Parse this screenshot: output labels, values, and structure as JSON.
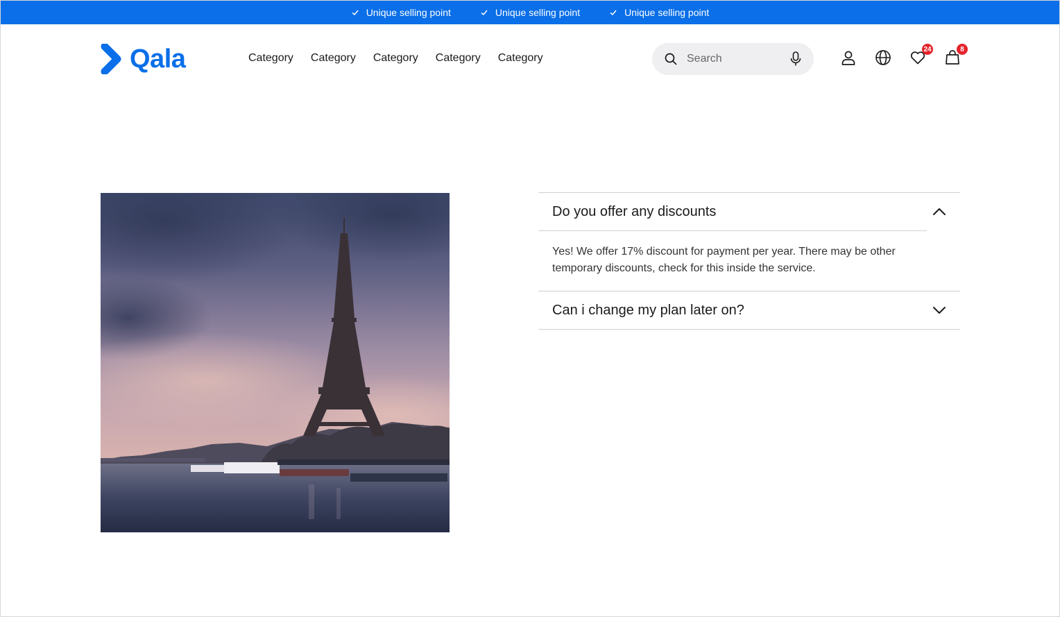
{
  "usp_bar": {
    "items": [
      "Unique selling point",
      "Unique selling point",
      "Unique selling point"
    ]
  },
  "header": {
    "logo_text": "Qala",
    "nav": [
      "Category",
      "Category",
      "Category",
      "Category",
      "Category"
    ],
    "search_placeholder": "Search",
    "wishlist_count": "24",
    "cart_count": "8"
  },
  "faq": {
    "items": [
      {
        "question": "Do you offer any discounts",
        "answer": "Yes! We offer 17% discount for payment per year. There may be other temporary discounts, check for this inside the service.",
        "expanded": true
      },
      {
        "question": "Can i change my plan later on?",
        "expanded": false
      }
    ]
  },
  "icons": {
    "usp": "check-icon",
    "logo": "chevron-right-logo-icon",
    "search": "search-icon",
    "mic": "microphone-icon",
    "account": "user-icon",
    "language": "globe-icon",
    "wishlist": "heart-icon",
    "cart": "shopping-bag-icon",
    "expanded": "chevron-up-icon",
    "collapsed": "chevron-down-icon"
  },
  "colors": {
    "brand": "#0a6fe8",
    "badge": "#e5242c",
    "search_bg": "#efeff1"
  }
}
